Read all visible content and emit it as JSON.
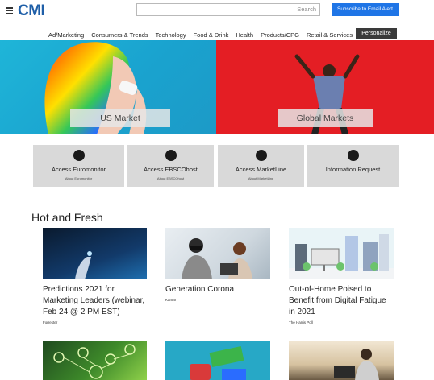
{
  "header": {
    "logo": "CMI",
    "search_placeholder": "Search",
    "subscribe_label": "Subscribe to Email Alert"
  },
  "nav": {
    "items": [
      "Ad/Marketing",
      "Consumers & Trends",
      "Technology",
      "Food & Drink",
      "Health",
      "Products/CPG",
      "Retail & Services"
    ],
    "personalize_label": "Personalize"
  },
  "hero": {
    "left_label": "US Market",
    "right_label": "Global Markets"
  },
  "access": [
    {
      "label": "Access Euromonitor",
      "sub": "About Euromonitor",
      "icon": "clock-arrow-icon"
    },
    {
      "label": "Access EBSCOhost",
      "sub": "About EBSCOhost",
      "icon": "clock-arrow-icon"
    },
    {
      "label": "Access MarketLine",
      "sub": "About MarketLine",
      "icon": "clock-arrow-icon"
    },
    {
      "label": "Information Request",
      "sub": "",
      "icon": "user-icon"
    }
  ],
  "section": {
    "title": "Hot and Fresh"
  },
  "cards": [
    {
      "title_lines": [
        "Predictions 2021 for",
        "Marketing Leaders (webinar,",
        "Feb 24 @ 2 PM EST)"
      ],
      "source": "Forrester"
    },
    {
      "title_lines": [
        "Generation Corona"
      ],
      "source": "Kantar"
    },
    {
      "title_lines": [
        "Out-of-Home Poised to",
        "Benefit from Digital Fatigue",
        "in 2021"
      ],
      "source": "The Harris Poll"
    }
  ],
  "colors": {
    "brand_blue": "#1f5fa8",
    "subscribe_blue": "#1f75e6",
    "hero_cyan": "#1fb5d8",
    "hero_red": "#e41e24",
    "tile_gray": "#d9d9d9"
  }
}
